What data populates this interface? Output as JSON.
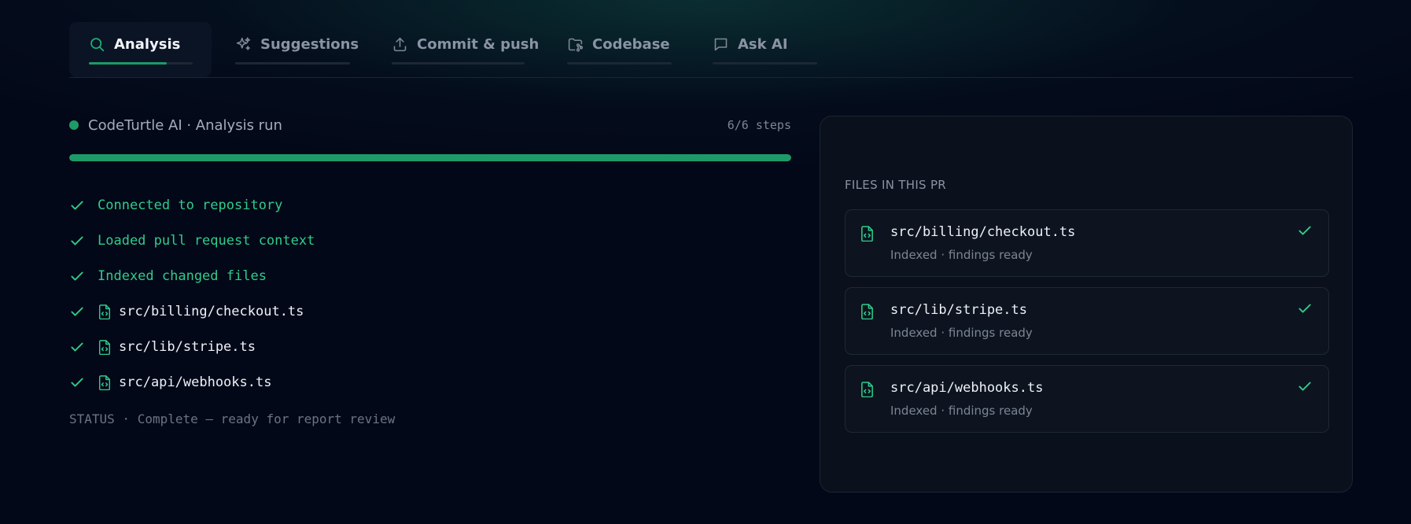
{
  "tabs": [
    {
      "label": "Analysis",
      "icon": "search-icon",
      "active": true,
      "progress": 0.75
    },
    {
      "label": "Suggestions",
      "icon": "sparkles-icon",
      "active": false,
      "progress": 0
    },
    {
      "label": "Commit & push",
      "icon": "upload-icon",
      "active": false,
      "progress": 0
    },
    {
      "label": "Codebase",
      "icon": "folder-git-icon",
      "active": false,
      "progress": 0
    },
    {
      "label": "Ask AI",
      "icon": "chat-icon",
      "active": false,
      "progress": 0
    }
  ],
  "run": {
    "title": "CodeTurtle AI · Analysis run",
    "steps_label": "6/6 steps",
    "progress": 1.0,
    "steps": [
      {
        "text": "Connected to repository",
        "kind": "done"
      },
      {
        "text": "Loaded pull request context",
        "kind": "done"
      },
      {
        "text": "Indexed changed files",
        "kind": "done"
      },
      {
        "text": "src/billing/checkout.ts",
        "kind": "file"
      },
      {
        "text": "src/lib/stripe.ts",
        "kind": "file"
      },
      {
        "text": "src/api/webhooks.ts",
        "kind": "file"
      }
    ],
    "status": "STATUS · Complete — ready for report review"
  },
  "files_panel": {
    "heading": "FILES IN THIS PR",
    "files": [
      {
        "name": "src/billing/checkout.ts",
        "meta": "Indexed · findings ready"
      },
      {
        "name": "src/lib/stripe.ts",
        "meta": "Indexed · findings ready"
      },
      {
        "name": "src/api/webhooks.ts",
        "meta": "Indexed · findings ready"
      }
    ]
  },
  "colors": {
    "accent": "#1e9a68",
    "done_text": "#2fcc8a",
    "background": "#030818"
  }
}
